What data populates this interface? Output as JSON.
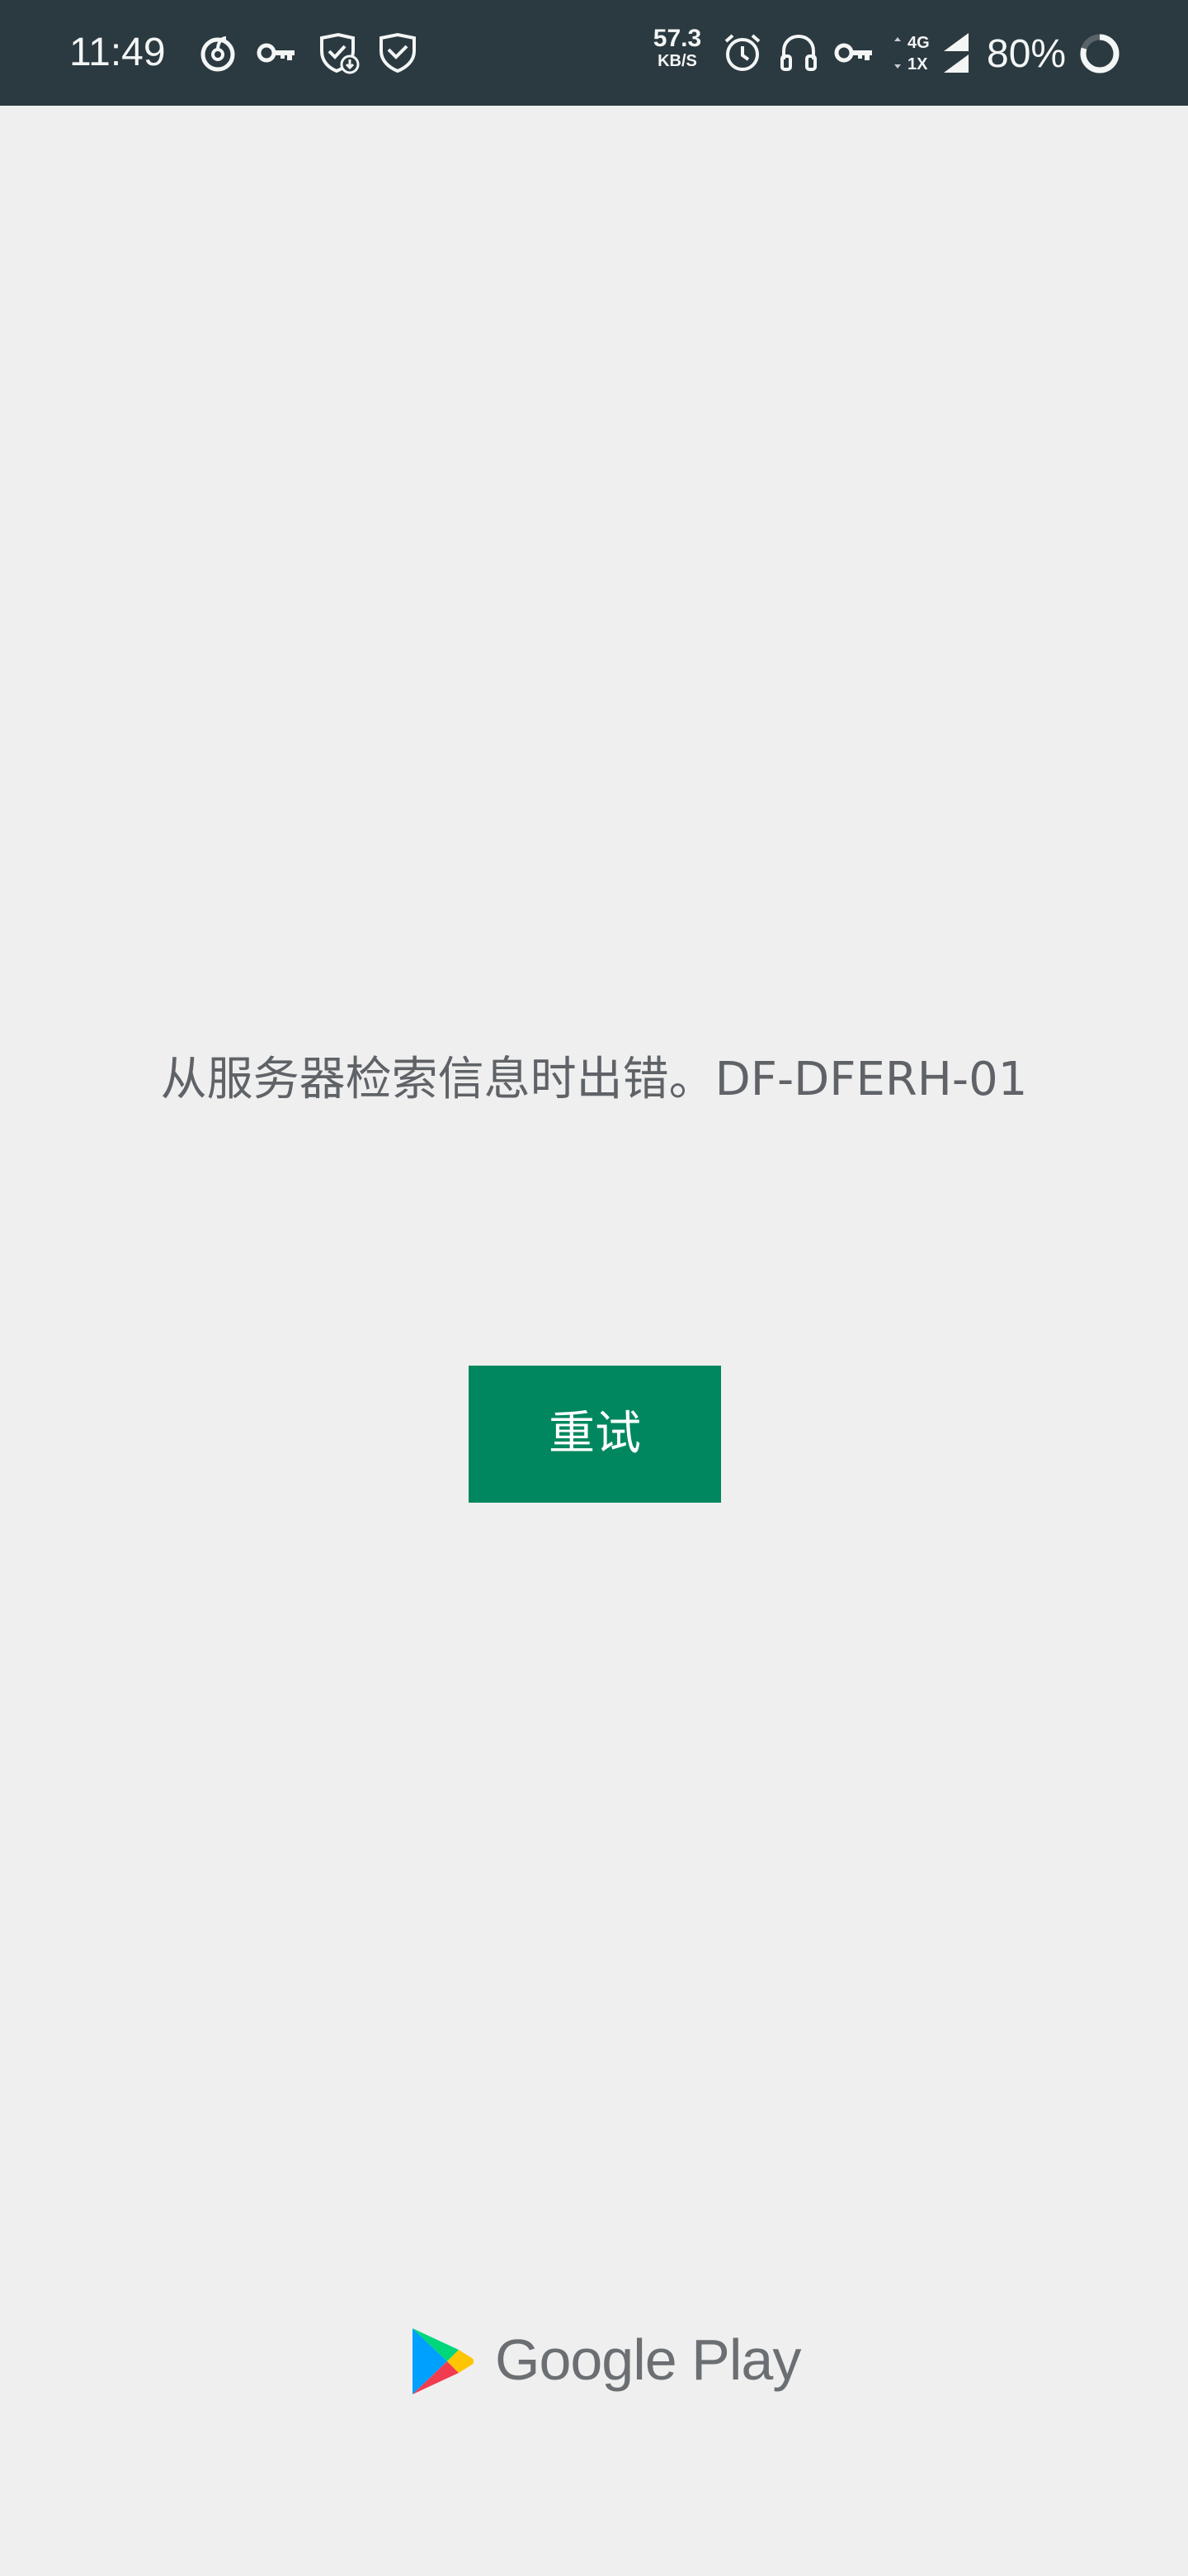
{
  "status_bar": {
    "time": "11:49",
    "network_speed_value": "57.3",
    "network_speed_unit": "KB/S",
    "network_type": "4G",
    "network_sub": "1X",
    "battery_percent": "80%",
    "battery_level": 0.8,
    "left_icons": [
      "netease-music-icon",
      "vpn-key-icon",
      "shield-check-download-icon",
      "shield-check-icon"
    ],
    "right_icons": [
      "alarm-icon",
      "headphones-icon",
      "vpn-key-icon",
      "signal-icon",
      "battery-ring-icon"
    ]
  },
  "main": {
    "error_message": "从服务器检索信息时出错。DF-DFERH-01",
    "retry_label": "重试"
  },
  "footer": {
    "brand": "Google Play"
  },
  "colors": {
    "status_bar_bg": "#2b3a40",
    "page_bg": "#efefef",
    "button_bg": "#01875f",
    "message_text": "#5f6368",
    "wordmark": "#6b6e72"
  }
}
